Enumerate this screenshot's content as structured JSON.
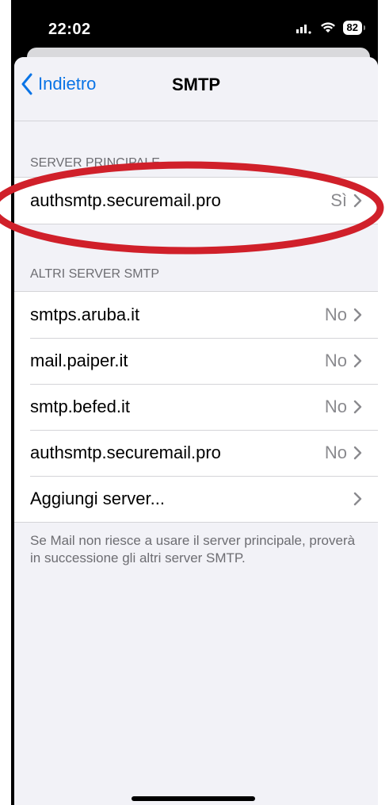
{
  "status": {
    "time": "22:02",
    "battery": "82",
    "icons": [
      "signal-icon",
      "wifi-icon",
      "battery-icon"
    ]
  },
  "nav": {
    "back_label": "Indietro",
    "title": "SMTP"
  },
  "primary": {
    "header": "SERVER PRINCIPALE",
    "row": {
      "label": "authsmtp.securemail.pro",
      "value": "Sì"
    }
  },
  "others": {
    "header": "ALTRI SERVER SMTP",
    "rows": [
      {
        "label": "smtps.aruba.it",
        "value": "No"
      },
      {
        "label": "mail.paiper.it",
        "value": "No"
      },
      {
        "label": "smtp.befed.it",
        "value": "No"
      },
      {
        "label": "authsmtp.securemail.pro",
        "value": "No"
      }
    ],
    "add_label": "Aggiungi server..."
  },
  "footer": {
    "note": "Se Mail non riesce a usare il server principale, proverà in successione gli altri server SMTP."
  },
  "colors": {
    "accent": "#0a74e6",
    "annotation": "#d0202a",
    "background": "#f2f2f7"
  }
}
